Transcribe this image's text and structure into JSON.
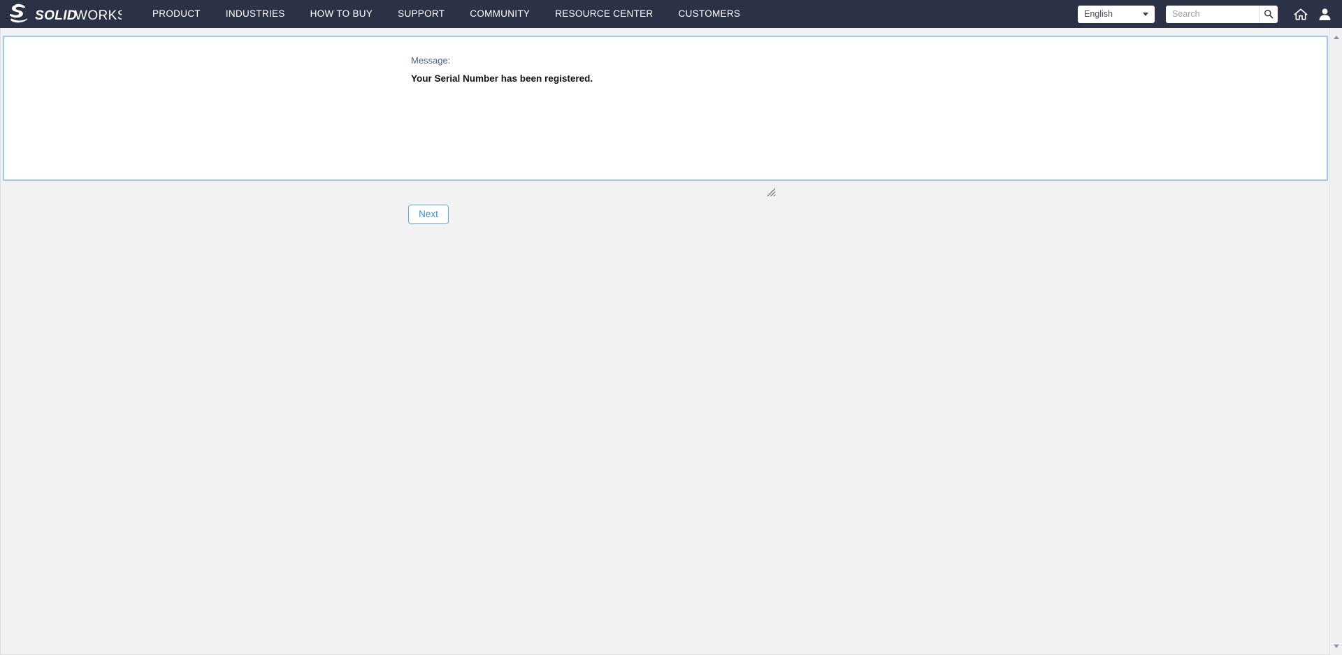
{
  "header": {
    "logo": {
      "icon": "3ds-swoosh-logo",
      "brand_bold": "SOLID",
      "brand_light": "WORKS"
    },
    "nav_items": [
      {
        "label": "PRODUCT",
        "name": "nav-product"
      },
      {
        "label": "INDUSTRIES",
        "name": "nav-industries"
      },
      {
        "label": "HOW TO BUY",
        "name": "nav-how-to-buy"
      },
      {
        "label": "SUPPORT",
        "name": "nav-support"
      },
      {
        "label": "COMMUNITY",
        "name": "nav-community"
      },
      {
        "label": "RESOURCE CENTER",
        "name": "nav-resource-center"
      },
      {
        "label": "CUSTOMERS",
        "name": "nav-customers"
      }
    ],
    "language": {
      "selected": "English",
      "caret_icon": "chevron-down-icon"
    },
    "search": {
      "value": "",
      "placeholder": "Search",
      "button_icon": "search-icon"
    },
    "home_icon": "home-icon",
    "account_icon": "user-icon",
    "background_color": "#2b3245",
    "text_color": "#ffffff"
  },
  "content": {
    "message_label": "Message:",
    "message_text": "Your Serial Number has been registered.",
    "next_button_label": "Next",
    "resize_handle_icon": "resize-grip-icon",
    "frame_border_color": "#9fc8e8",
    "button_accent_color": "#3a8fd0"
  },
  "scrollbar": {
    "up_icon": "scroll-up-arrow-icon",
    "down_icon": "scroll-down-arrow-icon"
  },
  "page": {
    "background_color": "#f2f2f2"
  }
}
